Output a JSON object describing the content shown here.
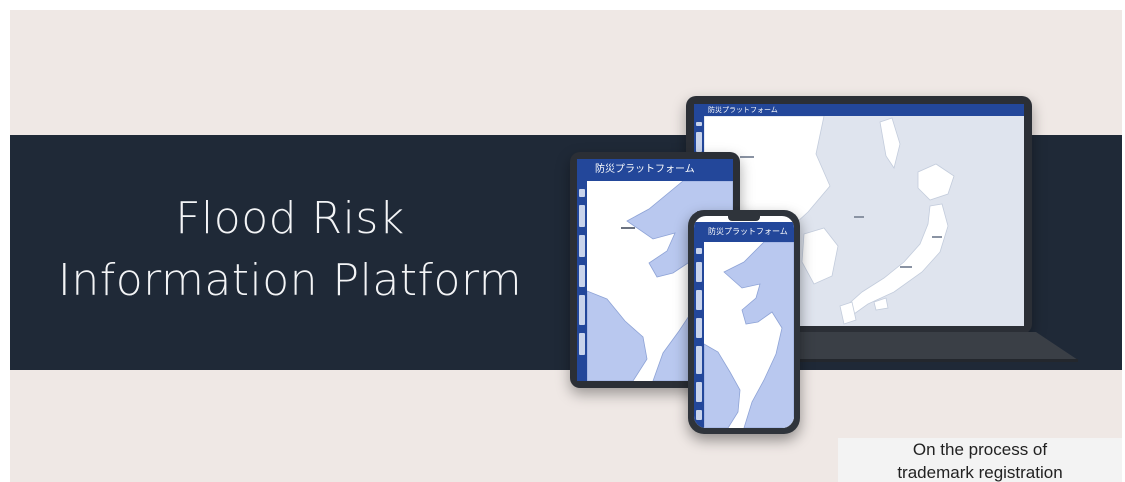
{
  "banner": {
    "title_line1": "Flood Risk",
    "title_line2": "Information Platform",
    "colors": {
      "background": "#efe8e5",
      "band": "#1f2937",
      "title_text": "#f3f4f6",
      "app_header": "#23479a",
      "map_water": "#dfe4ee",
      "map_land": "#ffffff",
      "map_highlight": "#b9c8ef"
    }
  },
  "devices": {
    "laptop_header": "防災プラットフォーム",
    "tablet_header": "防災プラットフォーム",
    "phone_header": "防災プラットフォーム"
  },
  "note": {
    "line1": "On the process of",
    "line2": "trademark registration"
  }
}
